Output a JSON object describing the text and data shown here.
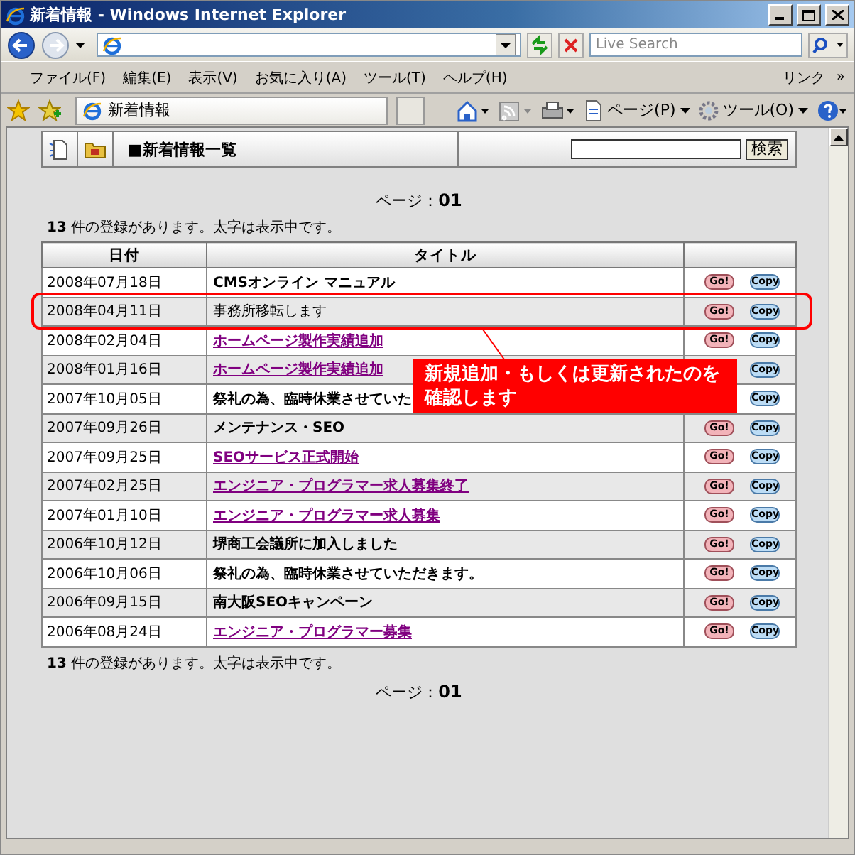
{
  "window": {
    "title": "新着情報 - Windows Internet Explorer"
  },
  "address_bar": {
    "search_placeholder": "Live Search"
  },
  "menu": [
    "ファイル(F)",
    "編集(E)",
    "表示(V)",
    "お気に入り(A)",
    "ツール(T)",
    "ヘルプ(H)"
  ],
  "links_label": "リンク",
  "links_more": "»",
  "tabs": [
    {
      "label": "新着情報",
      "selected": true
    }
  ],
  "command_bar": [
    "ページ(P)",
    "ツール(O)"
  ],
  "page": {
    "heading": "■新着情報一覧",
    "search_button": "検索",
    "pager": "ページ：**01**",
    "count_text": "**13** 件の登録があります。太字は表示中です。",
    "columns": [
      "日付",
      "タイトル"
    ],
    "rows": [
      {
        "date": "2008年07月18日",
        "title": "CMSオンライン マニュアル",
        "link": false,
        "displayed": true,
        "highlighted": false,
        "buttons": [
          {
            "label": "Go!",
            "kind": "go"
          },
          {
            "label": "Copy",
            "kind": "copy"
          }
        ]
      },
      {
        "date": "2008年04月11日",
        "title": "事務所移転します",
        "link": false,
        "displayed": false,
        "highlighted": true,
        "buttons": [
          {
            "label": "Go!",
            "kind": "go"
          },
          {
            "label": "Copy",
            "kind": "copy"
          }
        ]
      },
      {
        "date": "2008年02月04日",
        "title": "ホームページ製作実績追加",
        "link": true,
        "displayed": true,
        "highlighted": false,
        "buttons": [
          {
            "label": "Go!",
            "kind": "go"
          },
          {
            "label": "Copy",
            "kind": "copy"
          }
        ]
      },
      {
        "date": "2008年01月16日",
        "title": "ホームページ製作実績追加",
        "link": true,
        "displayed": true,
        "highlighted": false,
        "buttons": [
          {
            "label": "Copy",
            "kind": "copy"
          }
        ]
      },
      {
        "date": "2007年10月05日",
        "title": "祭礼の為、臨時休業させていた",
        "link": false,
        "displayed": true,
        "highlighted": false,
        "buttons": [
          {
            "label": "Copy",
            "kind": "copy"
          }
        ]
      },
      {
        "date": "2007年09月26日",
        "title": "メンテナンス・SEO",
        "link": false,
        "displayed": true,
        "highlighted": false,
        "buttons": [
          {
            "label": "Go!",
            "kind": "go"
          },
          {
            "label": "Copy",
            "kind": "copy"
          }
        ]
      },
      {
        "date": "2007年09月25日",
        "title": "SEOサービス正式開始",
        "link": true,
        "displayed": true,
        "highlighted": false,
        "buttons": [
          {
            "label": "Go!",
            "kind": "go"
          },
          {
            "label": "Copy",
            "kind": "copy"
          }
        ]
      },
      {
        "date": "2007年02月25日",
        "title": "エンジニア・プログラマー求人募集終了",
        "link": true,
        "displayed": true,
        "highlighted": false,
        "buttons": [
          {
            "label": "Go!",
            "kind": "go"
          },
          {
            "label": "Copy",
            "kind": "copy"
          }
        ]
      },
      {
        "date": "2007年01月10日",
        "title": "エンジニア・プログラマー求人募集",
        "link": true,
        "displayed": true,
        "highlighted": false,
        "buttons": [
          {
            "label": "Go!",
            "kind": "go"
          },
          {
            "label": "Copy",
            "kind": "copy"
          }
        ]
      },
      {
        "date": "2006年10月12日",
        "title": "堺商工会議所に加入しました",
        "link": false,
        "displayed": true,
        "highlighted": false,
        "buttons": [
          {
            "label": "Go!",
            "kind": "go"
          },
          {
            "label": "Copy",
            "kind": "copy"
          }
        ]
      },
      {
        "date": "2006年10月06日",
        "title": "祭礼の為、臨時休業させていただきます。",
        "link": false,
        "displayed": true,
        "highlighted": false,
        "buttons": [
          {
            "label": "Go!",
            "kind": "go"
          },
          {
            "label": "Copy",
            "kind": "copy"
          }
        ]
      },
      {
        "date": "2006年09月15日",
        "title": "南大阪SEOキャンペーン",
        "link": false,
        "displayed": true,
        "highlighted": false,
        "buttons": [
          {
            "label": "Go!",
            "kind": "go"
          },
          {
            "label": "Copy",
            "kind": "copy"
          }
        ]
      },
      {
        "date": "2006年08月24日",
        "title": "エンジニア・プログラマー募集",
        "link": true,
        "displayed": true,
        "highlighted": false,
        "buttons": [
          {
            "label": "Go!",
            "kind": "go"
          },
          {
            "label": "Copy",
            "kind": "copy"
          }
        ]
      }
    ],
    "count_text_bottom": "**13** 件の登録があります。太字は表示中です。",
    "pager_bottom": "ページ：**01**"
  },
  "callout": {
    "text": "新規追加・もしくは更新されたのを確認します"
  }
}
